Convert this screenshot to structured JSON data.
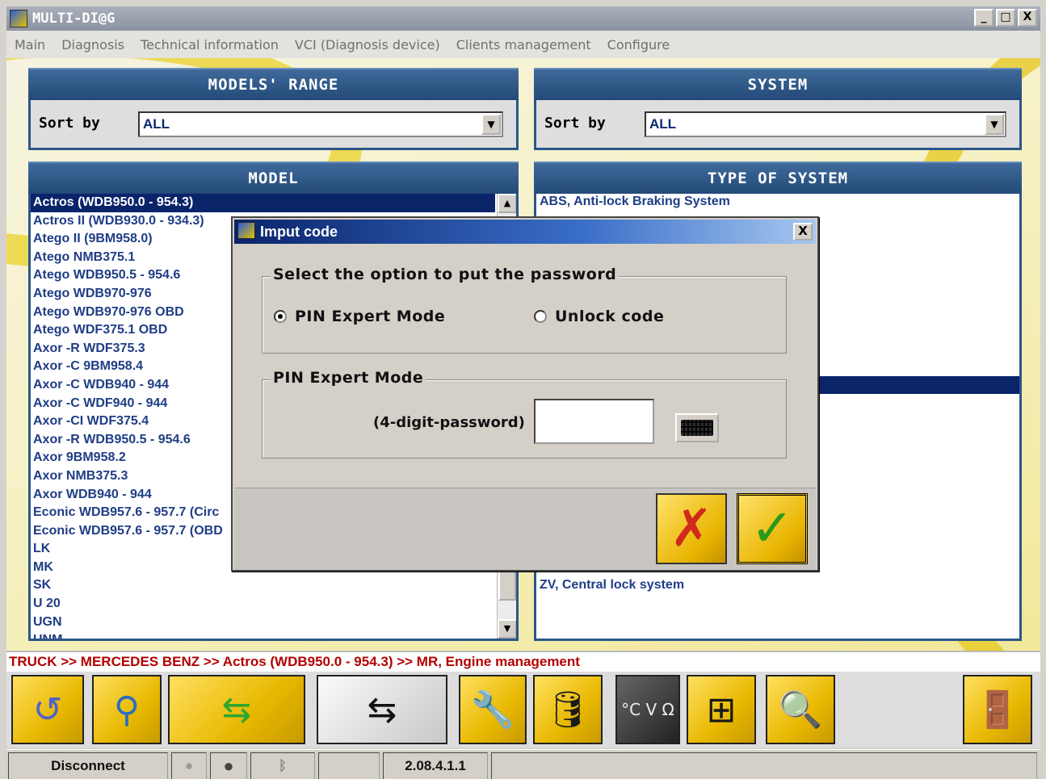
{
  "window": {
    "title": "MULTI-DI@G",
    "buttons": [
      "_",
      "□",
      "X"
    ]
  },
  "menu": [
    "Main",
    "Diagnosis",
    "Technical information",
    "VCI (Diagnosis device)",
    "Clients management",
    "Configure"
  ],
  "models_range": {
    "header": "MODELS' RANGE",
    "sort_label": "Sort by",
    "sort_value": "ALL"
  },
  "system": {
    "header": "SYSTEM",
    "sort_label": "Sort by",
    "sort_value": "ALL"
  },
  "model_list": {
    "header": "MODEL",
    "selected_index": 0,
    "items": [
      "Actros (WDB950.0 - 954.3)",
      "Actros II (WDB930.0 - 934.3)",
      "Atego II (9BM958.0)",
      "Atego NMB375.1",
      "Atego WDB950.5 - 954.6",
      "Atego WDB970-976",
      "Atego WDB970-976 OBD",
      "Atego WDF375.1 OBD",
      "Axor  -R WDF375.3",
      "Axor -C 9BM958.4",
      "Axor -C WDB940 - 944",
      "Axor -C WDF940 - 944",
      "Axor -CI WDF375.4",
      "Axor -R WDB950.5 - 954.6",
      "Axor 9BM958.2",
      "Axor NMB375.3",
      "Axor WDB940 - 944",
      "Econic WDB957.6 - 957.7 (Circ",
      "Econic WDB957.6 - 957.7 (OBD",
      "LK",
      "MK",
      "SK",
      "U 20",
      "UGN",
      "UNM"
    ]
  },
  "system_list": {
    "header": "TYPE OF SYSTEM",
    "items_visible": [
      "ABS, Anti-lock Braking System",
      "ZV, Central lock system"
    ]
  },
  "breadcrumb": "TRUCK >> MERCEDES BENZ >> Actros (WDB950.0 - 954.3) >> MR, Engine management",
  "toolbar": {
    "buttons": [
      {
        "name": "back",
        "glyph": "↺"
      },
      {
        "name": "connection",
        "glyph": "⚲"
      },
      {
        "name": "vehicle-green",
        "glyph": "⇆"
      },
      {
        "name": "vehicle-black",
        "glyph": "⇆"
      },
      {
        "name": "wrench",
        "glyph": "🔧"
      },
      {
        "name": "oil",
        "glyph": "🛢"
      },
      {
        "name": "units",
        "glyph": "°C V Ω"
      },
      {
        "name": "wiring",
        "glyph": "⊞"
      },
      {
        "name": "search",
        "glyph": "🔍"
      },
      {
        "name": "exit",
        "glyph": "🚪"
      }
    ]
  },
  "status": {
    "disconnect": "Disconnect",
    "version": "2.08.4.1.1"
  },
  "dialog": {
    "title": "Imput code",
    "close": "X",
    "group1_title": "Select the option to put the password",
    "radio_pin": "PIN Expert Mode",
    "radio_unlock": "Unlock code",
    "group2_title": "PIN Expert Mode",
    "password_label": "(4-digit-password)",
    "password_value": "",
    "cancel_glyph": "✗",
    "ok_glyph": "✓"
  },
  "colors": {
    "header_blue": "#234a78",
    "selection": "#0a246a",
    "accent_yellow": "#e8c000",
    "breadcrumb_red": "#b30000"
  }
}
